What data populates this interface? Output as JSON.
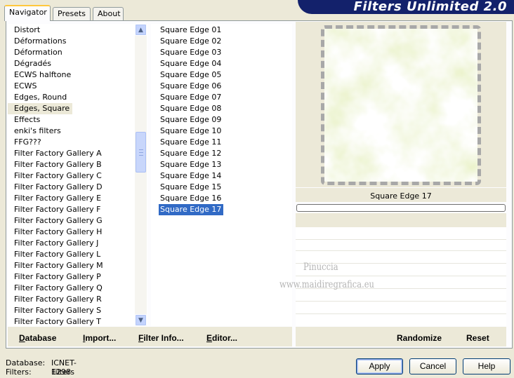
{
  "tabs": [
    "Navigator",
    "Presets",
    "About"
  ],
  "banner": "Filters Unlimited 2.0",
  "categories": [
    "Distort",
    "Déformations",
    "Déformation",
    "Dégradés",
    "ECWS halftone",
    "ECWS",
    "Edges, Round",
    "Edges, Square",
    "Effects",
    "enki's filters",
    "FFG???",
    "Filter Factory Gallery A",
    "Filter Factory Gallery B",
    "Filter Factory Gallery C",
    "Filter Factory Gallery D",
    "Filter Factory Gallery E",
    "Filter Factory Gallery F",
    "Filter Factory Gallery G",
    "Filter Factory Gallery H",
    "Filter Factory Gallery J",
    "Filter Factory Gallery L",
    "Filter Factory Gallery M",
    "Filter Factory Gallery P",
    "Filter Factory Gallery Q",
    "Filter Factory Gallery R",
    "Filter Factory Gallery S",
    "Filter Factory Gallery T"
  ],
  "selected_category": "Edges, Square",
  "filters": [
    "Square Edge 01",
    "Square Edge 02",
    "Square Edge 03",
    "Square Edge 04",
    "Square Edge 05",
    "Square Edge 06",
    "Square Edge 07",
    "Square Edge 08",
    "Square Edge 09",
    "Square Edge 10",
    "Square Edge 11",
    "Square Edge 12",
    "Square Edge 13",
    "Square Edge 14",
    "Square Edge 15",
    "Square Edge 16",
    "Square Edge 17"
  ],
  "selected_filter": "Square Edge 17",
  "preview_filter_name": "Square Edge 17",
  "watermark": {
    "line1": "Pinuccia",
    "line2": "www.maidiregrafica.eu"
  },
  "toolbar": {
    "database": "Database",
    "import": "Import...",
    "filter_info": "Filter Info...",
    "editor": "Editor...",
    "randomize": "Randomize",
    "reset": "Reset"
  },
  "status": {
    "database_label": "Database:",
    "database_value": "ICNET-Filters",
    "filters_label": "Filters:",
    "filters_value": "1298"
  },
  "buttons": {
    "apply": "Apply",
    "cancel": "Cancel",
    "help": "Help"
  },
  "colors": {
    "selection": "#316ac5",
    "banner": "#13216b",
    "preview_green": "#c6dc7a"
  }
}
